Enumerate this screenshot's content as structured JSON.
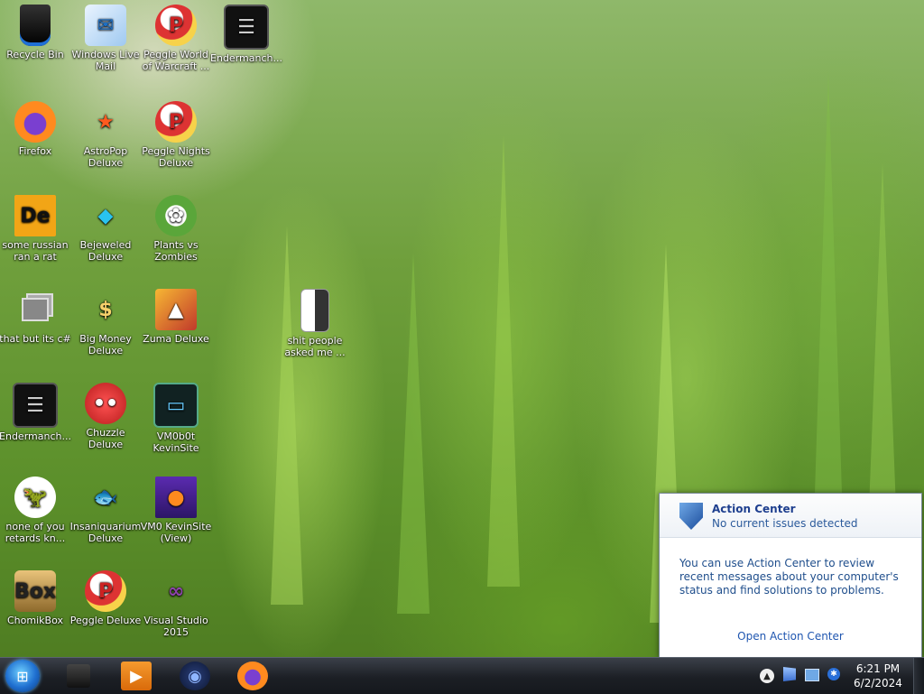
{
  "desktop": {
    "icons": [
      {
        "label": "Recycle Bin",
        "icon": "recycle-bin-icon"
      },
      {
        "label": "Windows Live Mail",
        "icon": "mail-icon"
      },
      {
        "label": "Peggle World of Warcraft ...",
        "icon": "peggle-icon"
      },
      {
        "label": "Endermanch...",
        "icon": "terminal-icon"
      },
      {
        "label": "Firefox",
        "icon": "firefox-icon"
      },
      {
        "label": "AstroPop Deluxe",
        "icon": "astropop-icon"
      },
      {
        "label": "Peggle Nights Deluxe",
        "icon": "peggle-icon"
      },
      {
        "label": "some russian ran a rat",
        "icon": "de-icon"
      },
      {
        "label": "Bejeweled Deluxe",
        "icon": "gem-icon"
      },
      {
        "label": "Plants vs Zombies",
        "icon": "plants-icon"
      },
      {
        "label": "that but its c#",
        "icon": "copy-icon"
      },
      {
        "label": "Big Money Deluxe",
        "icon": "money-bag-icon"
      },
      {
        "label": "Zuma Deluxe",
        "icon": "zuma-icon"
      },
      {
        "label": "shit people asked me ...",
        "icon": "folder-icon"
      },
      {
        "label": "Endermanch...",
        "icon": "terminal-icon"
      },
      {
        "label": "Chuzzle Deluxe",
        "icon": "chuzzle-icon"
      },
      {
        "label": "VM0b0t KevinSite",
        "icon": "monitor-icon"
      },
      {
        "label": "none of you retards kn...",
        "icon": "dino-icon"
      },
      {
        "label": "Insaniquarium Deluxe",
        "icon": "fish-icon"
      },
      {
        "label": "VM0 KevinSite (View)",
        "icon": "firefox-doc-icon"
      },
      {
        "label": "ChomikBox",
        "icon": "chomikbox-icon"
      },
      {
        "label": "Peggle Deluxe",
        "icon": "peggle-icon"
      },
      {
        "label": "Visual Studio 2015",
        "icon": "visual-studio-icon"
      }
    ]
  },
  "action_center": {
    "title": "Action Center",
    "status": "No current issues detected",
    "message": "You can use Action Center to review recent messages about your computer's status and find solutions to problems.",
    "link": "Open Action Center"
  },
  "taskbar": {
    "start_icon": "windows-logo-icon",
    "pinned": [
      "explorer-icon",
      "media-player-icon",
      "app-icon",
      "firefox-icon"
    ],
    "time": "6:21 PM",
    "date": "6/2/2024"
  },
  "colors": {
    "action_center_title": "#1e3f8f",
    "action_center_link": "#1f56b0",
    "taskbar_bg": "#1c1f25"
  }
}
